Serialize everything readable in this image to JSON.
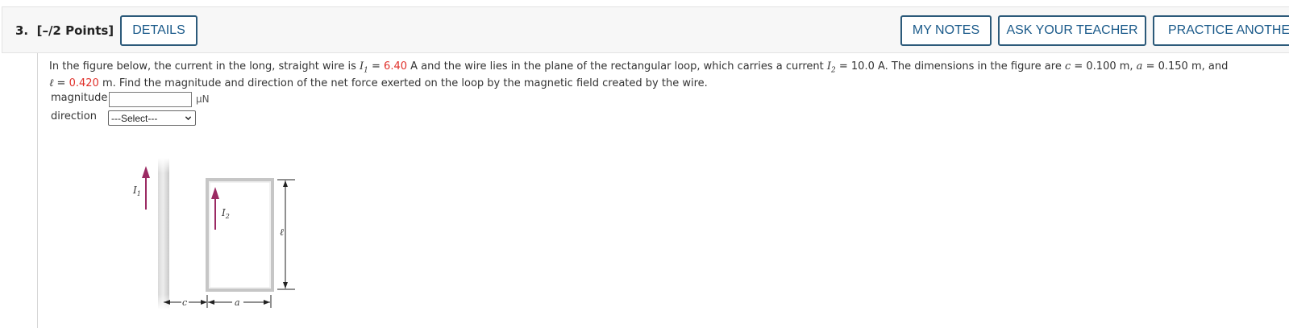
{
  "header": {
    "question_number": "3.",
    "points": "[–/2 Points]",
    "details_label": "DETAILS",
    "my_notes_label": "MY NOTES",
    "ask_teacher_label": "ASK YOUR TEACHER",
    "practice_label": "PRACTICE ANOTHER"
  },
  "question": {
    "t1": "In the figure below, the current in the long, straight wire is ",
    "i1_sym": "I",
    "i1_sub": "1",
    "eq": " = ",
    "i1_value": "6.40",
    "t2": " A  and the wire lies in the plane of the rectangular loop, which carries a current ",
    "i2_sym": "I",
    "i2_sub": "2",
    "i2_rest": " = 10.0 A.  The dimensions in the figure are  ",
    "c_sym": "c",
    "c_rest": " = 0.100 m,  ",
    "a_sym": "a",
    "a_rest": " = 0.150 m,  and",
    "l_sym": "ℓ",
    "l_value": "0.420",
    "t3": " m.  Find the magnitude and direction of the net force exerted on the loop by the magnetic field created by the wire."
  },
  "answer": {
    "magnitude_label": "magnitude",
    "magnitude_value": "",
    "magnitude_unit": "μN",
    "direction_label": "direction",
    "direction_selected": "---Select---"
  },
  "figure": {
    "label_i1": "I",
    "label_i1_sub": "1",
    "label_i2": "I",
    "label_i2_sub": "2",
    "label_l": "ℓ",
    "label_c": "c",
    "label_a": "a",
    "arrow_color": "#9b2a63"
  }
}
